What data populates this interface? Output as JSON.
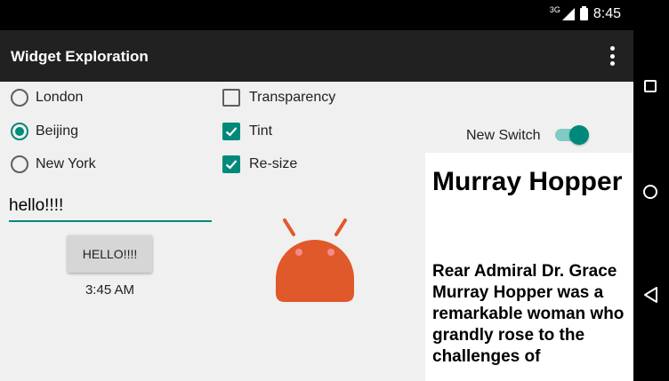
{
  "status_bar": {
    "network": "3G",
    "time": "8:45"
  },
  "app_bar": {
    "title": "Widget Exploration"
  },
  "radios": [
    {
      "label": "London",
      "checked": false
    },
    {
      "label": "Beijing",
      "checked": true
    },
    {
      "label": "New York",
      "checked": false
    }
  ],
  "checkboxes": [
    {
      "label": "Transparency",
      "checked": false
    },
    {
      "label": "Tint",
      "checked": true
    },
    {
      "label": "Re-size",
      "checked": true
    }
  ],
  "switch": {
    "label": "New Switch",
    "on": true
  },
  "edit_text": {
    "value": "hello!!!!"
  },
  "button": {
    "label": "HELLO!!!!"
  },
  "time_label": "3:45 AM",
  "text_panel": {
    "title": "Murray Hopper",
    "body": "Rear Admiral Dr. Grace Murray Hopper was a remarkable woman who grandly rose to the challenges of"
  },
  "colors": {
    "accent": "#00897b",
    "app_bar": "#212121",
    "android": "#e0592a"
  }
}
